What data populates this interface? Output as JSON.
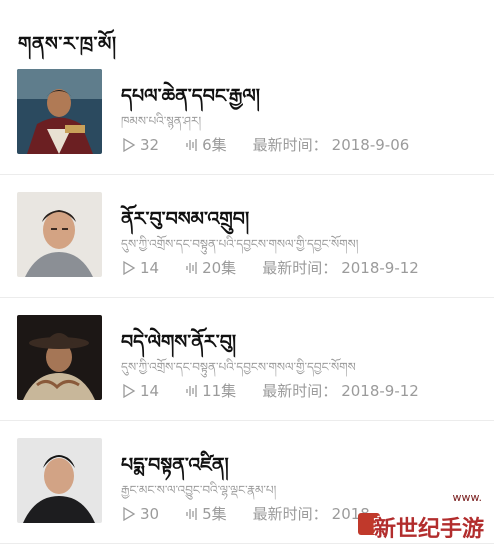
{
  "header": {
    "title": "གནས་ར་ཁྲ་མོ།"
  },
  "items": [
    {
      "title": "དཔལ་ཆེན་དབང་རྒྱལ།",
      "desc": "ཁམས་པའི་སྙན་ཤར།",
      "plays": "32",
      "episodes": "6集",
      "time_label": "最新时间：",
      "date": "2018-9-06"
    },
    {
      "title": "ནོར་བུ་བསམ་འགྲུབ།",
      "desc": "དུས་ཀྱི་འགྲོས་དང་བསྟུན་པའི་དབྱངས་གསལ་གྱི་དབྱང་སོགས།",
      "plays": "14",
      "episodes": "20集",
      "time_label": "最新时间：",
      "date": "2018-9-12"
    },
    {
      "title": "བདེ་ལེགས་ནོར་བུ།",
      "desc": "དུས་ཀྱི་འགྲོས་དང་བསྟུན་པའི་དབྱངས་གསལ་གྱི་དབྱང་སོགས",
      "plays": "14",
      "episodes": "11集",
      "time_label": "最新时间：",
      "date": "2018-9-12"
    },
    {
      "title": "པདྨ་བསྟན་འཛིན།",
      "desc": "རྒྱང་མང་ས་ལ་འབྱུང་བའི་ལྷ་ལྡང་རྣམ་པ།",
      "plays": "30",
      "episodes": "5集",
      "time_label": "最新时间：",
      "date": "2018-"
    }
  ],
  "watermark": {
    "text": "新世纪手游",
    "site": "www."
  },
  "icons": [
    "play-icon",
    "audio-wave-icon"
  ],
  "colors": {
    "meta": "#9b9b9b",
    "title": "#111111",
    "divider": "#ececec"
  }
}
